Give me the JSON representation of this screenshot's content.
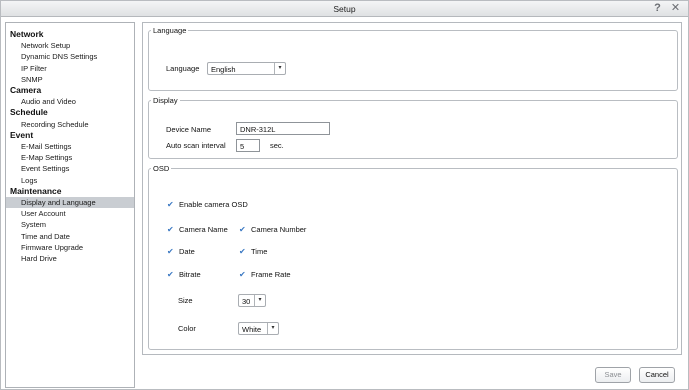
{
  "window": {
    "title": "Setup"
  },
  "sidebar": {
    "items": [
      {
        "label": "Network",
        "kind": "head"
      },
      {
        "label": "Network Setup",
        "kind": "sub"
      },
      {
        "label": "Dynamic DNS Settings",
        "kind": "sub"
      },
      {
        "label": "IP Filter",
        "kind": "sub"
      },
      {
        "label": "SNMP",
        "kind": "sub"
      },
      {
        "label": "Camera",
        "kind": "head"
      },
      {
        "label": "Audio and Video",
        "kind": "sub"
      },
      {
        "label": "Schedule",
        "kind": "head"
      },
      {
        "label": "Recording Schedule",
        "kind": "sub"
      },
      {
        "label": "Event",
        "kind": "head"
      },
      {
        "label": "E-Mail Settings",
        "kind": "sub"
      },
      {
        "label": "E-Map Settings",
        "kind": "sub"
      },
      {
        "label": "Event Settings",
        "kind": "sub"
      },
      {
        "label": "Logs",
        "kind": "sub"
      },
      {
        "label": "Maintenance",
        "kind": "head"
      },
      {
        "label": "Display and Language",
        "kind": "sub",
        "selected": true
      },
      {
        "label": "User Account",
        "kind": "sub"
      },
      {
        "label": "System",
        "kind": "sub"
      },
      {
        "label": "Time and Date",
        "kind": "sub"
      },
      {
        "label": "Firmware Upgrade",
        "kind": "sub"
      },
      {
        "label": "Hard Drive",
        "kind": "sub"
      }
    ]
  },
  "language_group": {
    "legend": "Language",
    "label": "Language",
    "value": "English"
  },
  "display_group": {
    "legend": "Display",
    "device_name_label": "Device Name",
    "device_name_value": "DNR-312L",
    "scan_label": "Auto scan interval",
    "scan_value": "5",
    "scan_unit": "sec."
  },
  "osd_group": {
    "legend": "OSD",
    "enable_label": "Enable camera OSD",
    "camera_name_label": "Camera Name",
    "camera_number_label": "Camera Number",
    "date_label": "Date",
    "time_label": "Time",
    "bitrate_label": "Bitrate",
    "frame_rate_label": "Frame Rate",
    "size_label": "Size",
    "size_value": "30",
    "color_label": "Color",
    "color_value": "White",
    "checked": {
      "enable": true,
      "camera_name": true,
      "camera_number": true,
      "date": true,
      "time": true,
      "bitrate": true,
      "frame_rate": true
    }
  },
  "footer": {
    "save_label": "Save",
    "cancel_label": "Cancel"
  },
  "icons": {
    "help": "help-icon",
    "close": "close-icon",
    "checkbox": "checkmark-icon",
    "dropdown": "chevron-down-icon"
  },
  "colors": {
    "selected_row": "#c9cdd2",
    "checkmark": "#3a78c2"
  }
}
